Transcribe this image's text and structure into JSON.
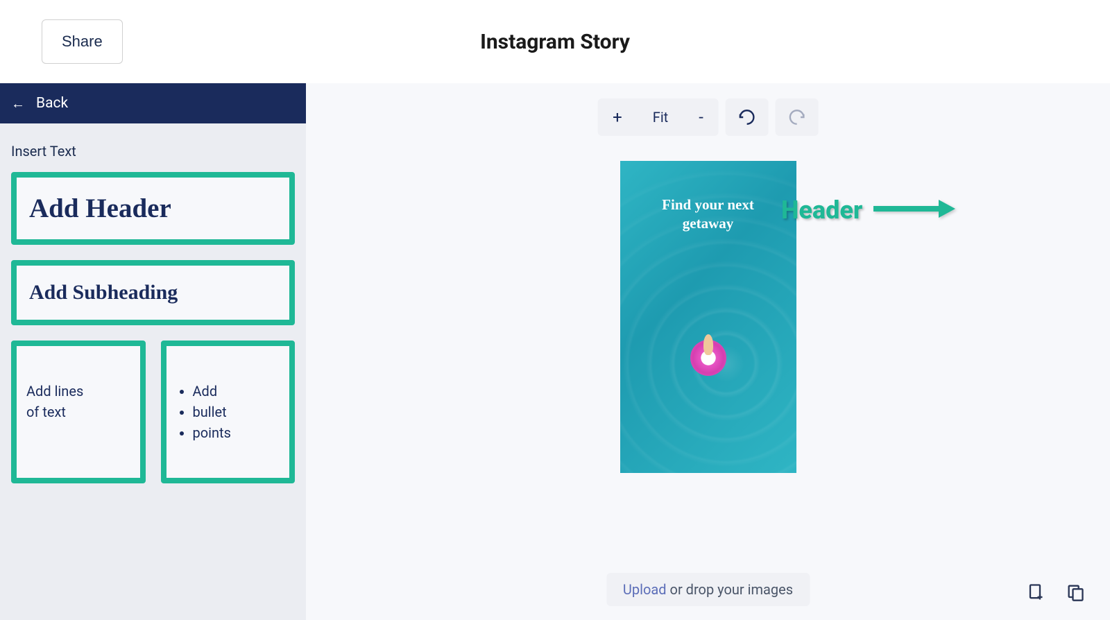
{
  "topbar": {
    "share_label": "Share",
    "title": "Instagram Story"
  },
  "sidebar": {
    "back_label": "Back",
    "section_title": "Insert Text",
    "options": {
      "header": "Add Header",
      "subheading": "Add Subheading",
      "lines_l1": "Add lines",
      "lines_l2": "of text",
      "bullets": [
        "Add",
        "bullet",
        "points"
      ]
    }
  },
  "toolbar": {
    "zoom_in": "+",
    "fit_label": "Fit",
    "zoom_out": "-"
  },
  "preview": {
    "header_l1": "Find your next",
    "header_l2": "getaway"
  },
  "annotation": {
    "label": "Header"
  },
  "upload": {
    "link": "Upload",
    "rest": " or drop your images"
  }
}
